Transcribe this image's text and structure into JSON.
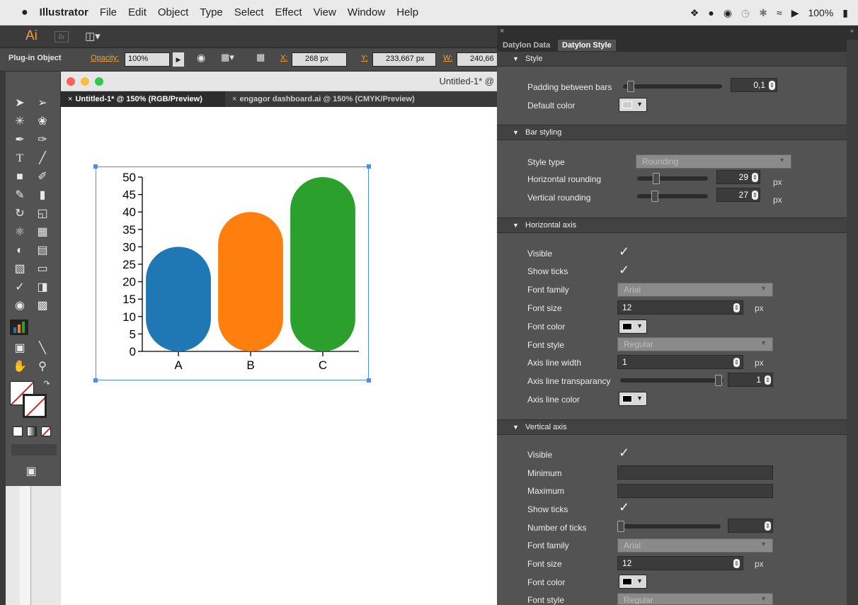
{
  "menubar": {
    "apple": "",
    "items": [
      "Illustrator",
      "File",
      "Edit",
      "Object",
      "Type",
      "Select",
      "Effect",
      "View",
      "Window",
      "Help"
    ],
    "battery": "100%"
  },
  "appbar": {
    "logo": "Ai",
    "br": "Br"
  },
  "control": {
    "object_type": "Plug-in Object",
    "opacity_label": "Opacity:",
    "opacity_value": "100%",
    "x_label": "X:",
    "x_value": "268 px",
    "y_label": "Y:",
    "y_value": "233,667 px",
    "w_label": "W:",
    "w_value": "240,66"
  },
  "document": {
    "title": "Untitled-1* @",
    "tabs": [
      "Untitled-1* @ 150% (RGB/Preview)",
      "engagor dashboard.ai @ 150% (CMYK/Preview)"
    ]
  },
  "chart_data": {
    "type": "bar",
    "categories": [
      "A",
      "B",
      "C"
    ],
    "values": [
      30,
      40,
      50
    ],
    "colors": [
      "#1f77b4",
      "#ff7f0e",
      "#2ca02c"
    ],
    "ylim": [
      0,
      50
    ],
    "yticks": [
      0,
      5,
      10,
      15,
      20,
      25,
      30,
      35,
      40,
      45,
      50
    ],
    "title": "",
    "xlabel": "",
    "ylabel": ""
  },
  "panel": {
    "tabs": [
      "Datylon Data",
      "Datylon Style"
    ],
    "style": {
      "header": "Style",
      "padding_label": "Padding between bars",
      "padding_value": "0,1",
      "default_color_label": "Default color"
    },
    "bar_styling": {
      "header": "Bar styling",
      "style_type_label": "Style type",
      "style_type_value": "Rounding",
      "h_round_label": "Horizontal rounding",
      "h_round_value": "29",
      "v_round_label": "Vertical rounding",
      "v_round_value": "27",
      "unit": "px"
    },
    "haxis": {
      "header": "Horizontal axis",
      "visible_label": "Visible",
      "ticks_label": "Show ticks",
      "font_family_label": "Font family",
      "font_family_value": "Arial",
      "font_size_label": "Font size",
      "font_size_value": "12",
      "font_color_label": "Font color",
      "font_style_label": "Font style",
      "font_style_value": "Regular",
      "line_width_label": "Axis line width",
      "line_width_value": "1",
      "transparency_label": "Axis line transparancy",
      "transparency_value": "1",
      "line_color_label": "Axis line color",
      "unit": "px"
    },
    "vaxis": {
      "header": "Vertical axis",
      "visible_label": "Visible",
      "min_label": "Minimum",
      "max_label": "Maximum",
      "ticks_label": "Show ticks",
      "num_ticks_label": "Number of ticks",
      "font_family_label": "Font family",
      "font_family_value": "Arial",
      "font_size_label": "Font size",
      "font_size_value": "12",
      "font_color_label": "Font color",
      "font_style_label": "Font style",
      "font_style_value": "Regular",
      "unit": "px"
    }
  }
}
